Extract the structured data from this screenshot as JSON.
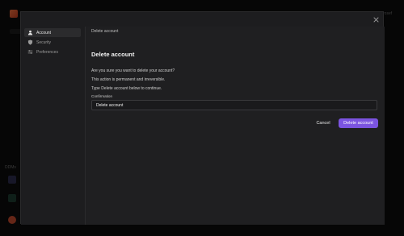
{
  "background": {
    "sidebar_section_label": "DDMs",
    "corner_text": "rosef"
  },
  "modal": {
    "sidebar": {
      "items": [
        {
          "label": "Account",
          "icon": "user-icon",
          "active": true
        },
        {
          "label": "Security",
          "icon": "shield-icon",
          "active": false
        },
        {
          "label": "Preferences",
          "icon": "sliders-icon",
          "active": false
        }
      ]
    },
    "breadcrumb": "Delete account",
    "title": "Delete account",
    "paragraphs": [
      "Are you sure you want to delete your account?",
      "This action is permanent and irreversible.",
      "Type Delete account below to continue."
    ],
    "confirmation_label": "Confirmation",
    "confirmation_value": "Delete account",
    "cancel_label": "Cancel",
    "delete_label": "Delete account",
    "accent_color": "#7b54e0"
  }
}
